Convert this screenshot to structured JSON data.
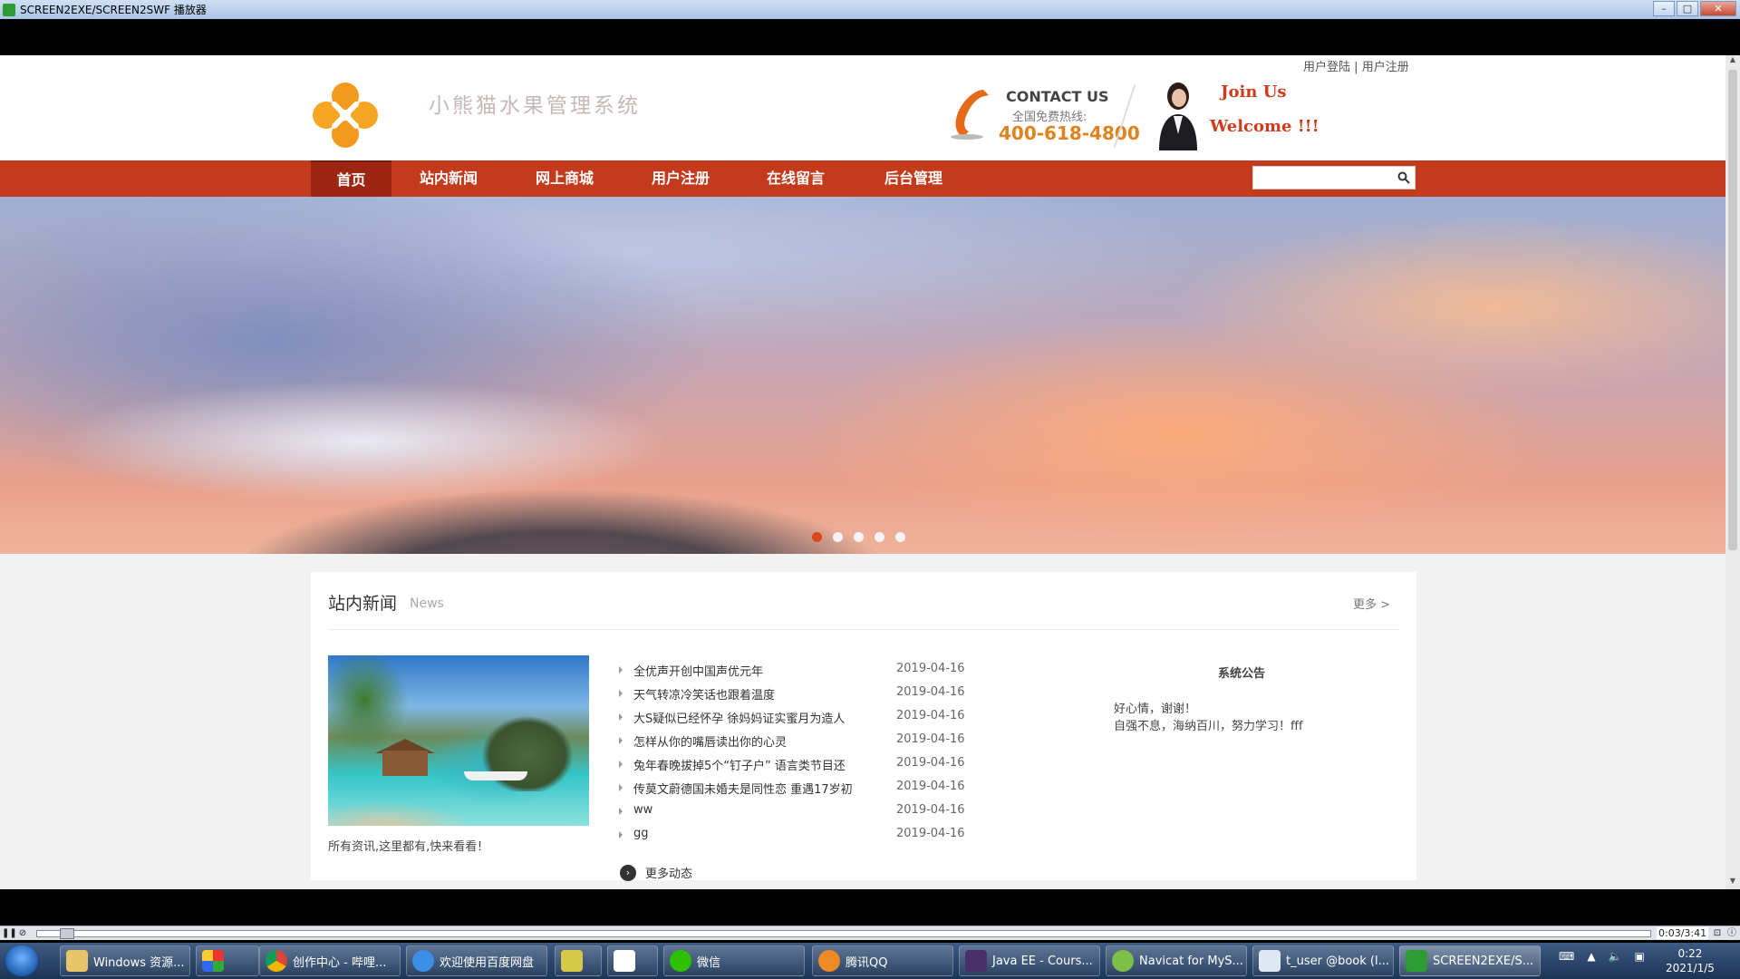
{
  "window": {
    "title": "SCREEN2EXE/SCREEN2SWF 播放器"
  },
  "header": {
    "user_login": "用户登陆",
    "separator": "|",
    "user_register": "用户注册",
    "site_name": "小熊猫水果管理系统",
    "contact_title": "CONTACT US",
    "contact_sub": "全国免费热线:",
    "contact_phone": "400-618-4800",
    "join": "Join Us",
    "welcome": "Welcome !!!"
  },
  "nav": {
    "items": [
      {
        "label": "首页"
      },
      {
        "label": "站内新闻"
      },
      {
        "label": "网上商城"
      },
      {
        "label": "用户注册"
      },
      {
        "label": "在线留言"
      },
      {
        "label": "后台管理"
      }
    ],
    "search_value": ""
  },
  "news": {
    "heading": "站内新闻",
    "heading_en": "News",
    "more": "更多 >",
    "caption": "所有资讯,这里都有,快来看看！",
    "items": [
      {
        "title": "全优声开创中国声优元年",
        "date": "2019-04-16"
      },
      {
        "title": "天气转凉冷笑话也跟着温度",
        "date": "2019-04-16"
      },
      {
        "title": "大S疑似已经怀孕 徐妈妈证实蜜月为造人",
        "date": "2019-04-16"
      },
      {
        "title": "怎样从你的嘴唇读出你的心灵",
        "date": "2019-04-16"
      },
      {
        "title": "兔年春晚拔掉5个“钉子户” 语言类节目还",
        "date": "2019-04-16"
      },
      {
        "title": "传莫文蔚德国未婚夫是同性恋 重遇17岁初",
        "date": "2019-04-16"
      },
      {
        "title": "ww",
        "date": "2019-04-16"
      },
      {
        "title": "gg",
        "date": "2019-04-16"
      }
    ],
    "more_news": "更多动态"
  },
  "notice": {
    "title": "系统公告",
    "line1": "好心情，谢谢！",
    "line2": "自强不息，海纳百川，努力学习！fff"
  },
  "player": {
    "time": "0:03/3:41"
  },
  "taskbar": {
    "tasks": [
      {
        "label": "Windows 资源..."
      },
      {
        "label": ""
      },
      {
        "label": "创作中心 - 哔哩..."
      },
      {
        "label": "欢迎使用百度网盘"
      },
      {
        "label": ""
      },
      {
        "label": ""
      },
      {
        "label": "微信"
      },
      {
        "label": "腾讯QQ"
      },
      {
        "label": "Java EE - Cours..."
      },
      {
        "label": "Navicat for MyS..."
      },
      {
        "label": "t_user @book (l..."
      },
      {
        "label": "SCREEN2EXE/S..."
      }
    ],
    "clock_time": "0:22",
    "clock_date": "2021/1/5"
  },
  "colors": {
    "nav_bg": "#c33a1c",
    "nav_active": "#9e2512",
    "phone_orange": "#e0821e",
    "join_red": "#d13b1c",
    "slider_active": "#d9461f"
  }
}
